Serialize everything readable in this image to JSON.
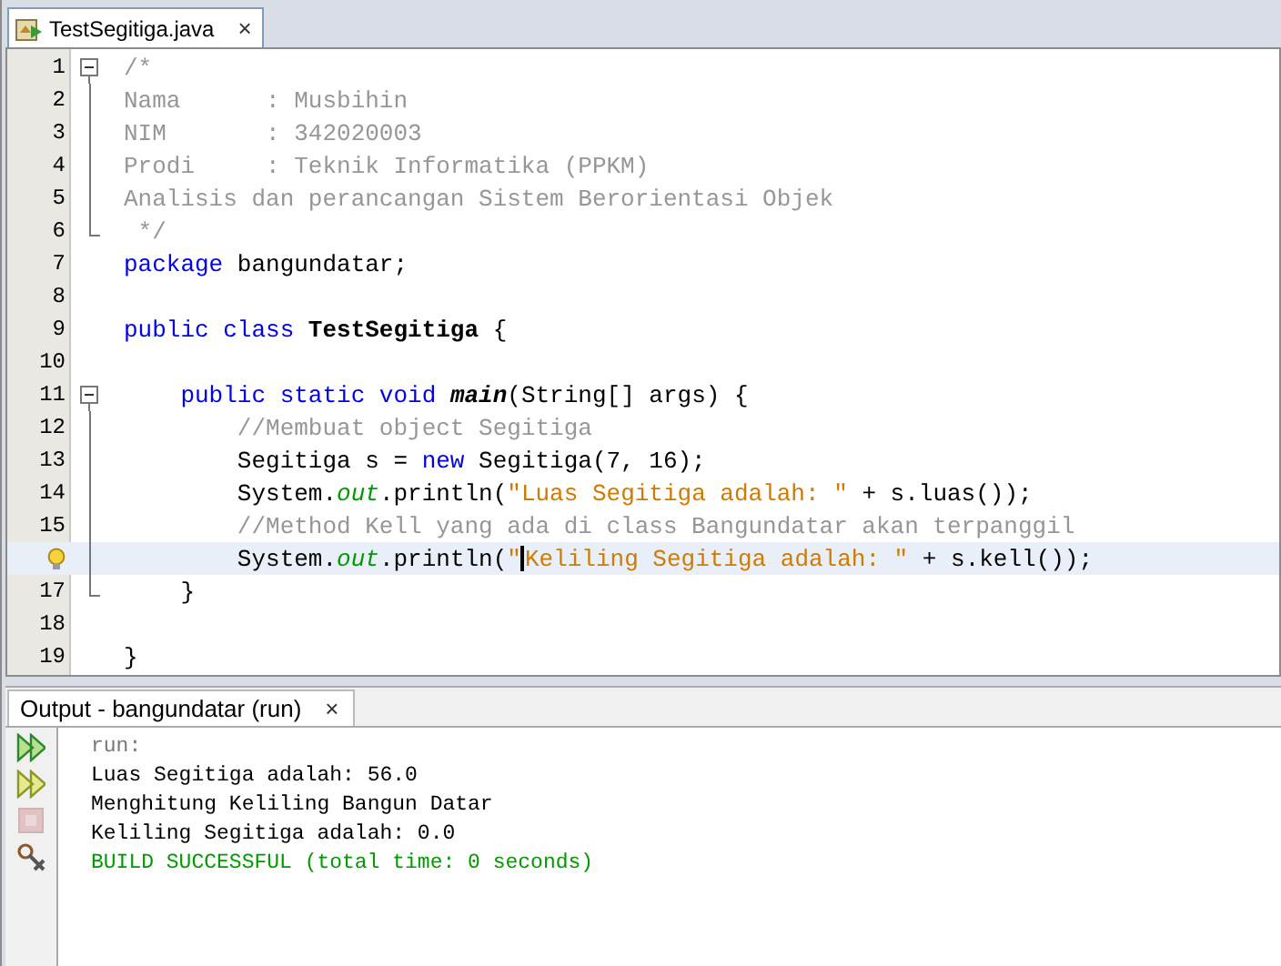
{
  "editor": {
    "tab": {
      "label": "TestSegitiga.java",
      "close": "×",
      "selected": true
    },
    "lines": [
      {
        "number": "1",
        "kind": "fold-start",
        "hint": false,
        "current": false,
        "tokens": [
          {
            "t": "/*",
            "kind": "comment"
          }
        ]
      },
      {
        "number": "2",
        "kind": "fold-body",
        "hint": false,
        "current": false,
        "tokens": [
          {
            "t": "Nama      : Musbihin",
            "kind": "comment"
          }
        ]
      },
      {
        "number": "3",
        "kind": "fold-body",
        "hint": false,
        "current": false,
        "tokens": [
          {
            "t": "NIM       : 342020003",
            "kind": "comment"
          }
        ]
      },
      {
        "number": "4",
        "kind": "fold-body",
        "hint": false,
        "current": false,
        "tokens": [
          {
            "t": "Prodi     : Teknik Informatika (PPKM)",
            "kind": "comment"
          }
        ]
      },
      {
        "number": "5",
        "kind": "fold-body",
        "hint": false,
        "current": false,
        "tokens": [
          {
            "t": "Analisis dan perancangan Sistem Berorientasi Objek",
            "kind": "comment"
          }
        ]
      },
      {
        "number": "6",
        "kind": "fold-end",
        "hint": false,
        "current": false,
        "tokens": [
          {
            "t": " */",
            "kind": "comment"
          }
        ]
      },
      {
        "number": "7",
        "kind": "plain",
        "hint": false,
        "current": false,
        "tokens": [
          {
            "t": "package",
            "kind": "keyword"
          },
          {
            "t": " bangundatar;",
            "kind": "plain"
          }
        ]
      },
      {
        "number": "8",
        "kind": "plain",
        "hint": false,
        "current": false
      },
      {
        "number": "9",
        "kind": "plain",
        "hint": false,
        "current": false,
        "tokens": [
          {
            "t": "public class ",
            "kind": "keyword"
          },
          {
            "t": "TestSegitiga",
            "kind": "bold"
          },
          {
            "t": " {",
            "kind": "plain"
          }
        ]
      },
      {
        "number": "10",
        "kind": "plain",
        "hint": false,
        "current": false
      },
      {
        "number": "11",
        "kind": "fold-start",
        "hint": false,
        "current": false,
        "tokens": [
          {
            "t": "    public static void ",
            "kind": "keyword"
          },
          {
            "t": "main",
            "kind": "method"
          },
          {
            "t": "(String[] args) {",
            "kind": "plain"
          }
        ]
      },
      {
        "number": "12",
        "kind": "fold-body",
        "hint": false,
        "current": false,
        "tokens": [
          {
            "t": "        //Membuat object Segitiga",
            "kind": "comment"
          }
        ]
      },
      {
        "number": "13",
        "kind": "fold-body",
        "hint": false,
        "current": false,
        "tokens": [
          {
            "t": "        Segitiga s = ",
            "kind": "plain"
          },
          {
            "t": "new",
            "kind": "keyword"
          },
          {
            "t": " Segitiga(7, 16);",
            "kind": "plain"
          }
        ]
      },
      {
        "number": "14",
        "kind": "fold-body",
        "hint": false,
        "current": false,
        "tokens": [
          {
            "t": "        System.",
            "kind": "plain"
          },
          {
            "t": "out",
            "kind": "field"
          },
          {
            "t": ".println(",
            "kind": "plain"
          },
          {
            "t": "\"Luas Segitiga adalah: \"",
            "kind": "string"
          },
          {
            "t": " + s.luas());",
            "kind": "plain"
          }
        ]
      },
      {
        "number": "15",
        "kind": "fold-body",
        "hint": false,
        "current": false,
        "tokens": [
          {
            "t": "        //Method Kell yang ada di class Bangundatar akan terpanggil",
            "kind": "comment"
          }
        ]
      },
      {
        "kind": "fold-body",
        "hint": true,
        "current": true,
        "tokens": [
          {
            "t": "        System.",
            "kind": "plain"
          },
          {
            "t": "out",
            "kind": "field"
          },
          {
            "t": ".println(",
            "kind": "plain"
          },
          {
            "t": "\"",
            "kind": "string"
          },
          {
            "kind": "caret"
          },
          {
            "t": "Keliling Segitiga adalah: \"",
            "kind": "string"
          },
          {
            "t": " + s.kell());",
            "kind": "plain"
          }
        ]
      },
      {
        "number": "17",
        "kind": "fold-end",
        "hint": false,
        "current": false,
        "tokens": [
          {
            "t": "    }",
            "kind": "plain"
          }
        ]
      },
      {
        "number": "18",
        "kind": "plain",
        "hint": false,
        "current": false
      },
      {
        "number": "19",
        "kind": "plain",
        "hint": false,
        "current": false,
        "tokens": [
          {
            "t": "}",
            "kind": "plain"
          }
        ]
      }
    ]
  },
  "output": {
    "tab": {
      "label": "Output - bangundatar (run)",
      "close": "×",
      "selected": true
    },
    "buttons": [
      {
        "kind": "rerun",
        "disabled": false
      },
      {
        "kind": "rerun-options",
        "disabled": false
      },
      {
        "kind": "stop",
        "disabled": true
      },
      {
        "kind": "settings",
        "disabled": false
      }
    ],
    "lines": [
      {
        "text": "run:",
        "kind": "info"
      },
      {
        "text": "Luas Segitiga adalah: 56.0",
        "kind": "normal"
      },
      {
        "text": "Menghitung Keliling Bangun Datar",
        "kind": "normal"
      },
      {
        "text": "Keliling Segitiga adalah: 0.0",
        "kind": "normal"
      },
      {
        "text": "BUILD SUCCESSFUL (total time: 0 seconds)",
        "kind": "success"
      }
    ]
  }
}
